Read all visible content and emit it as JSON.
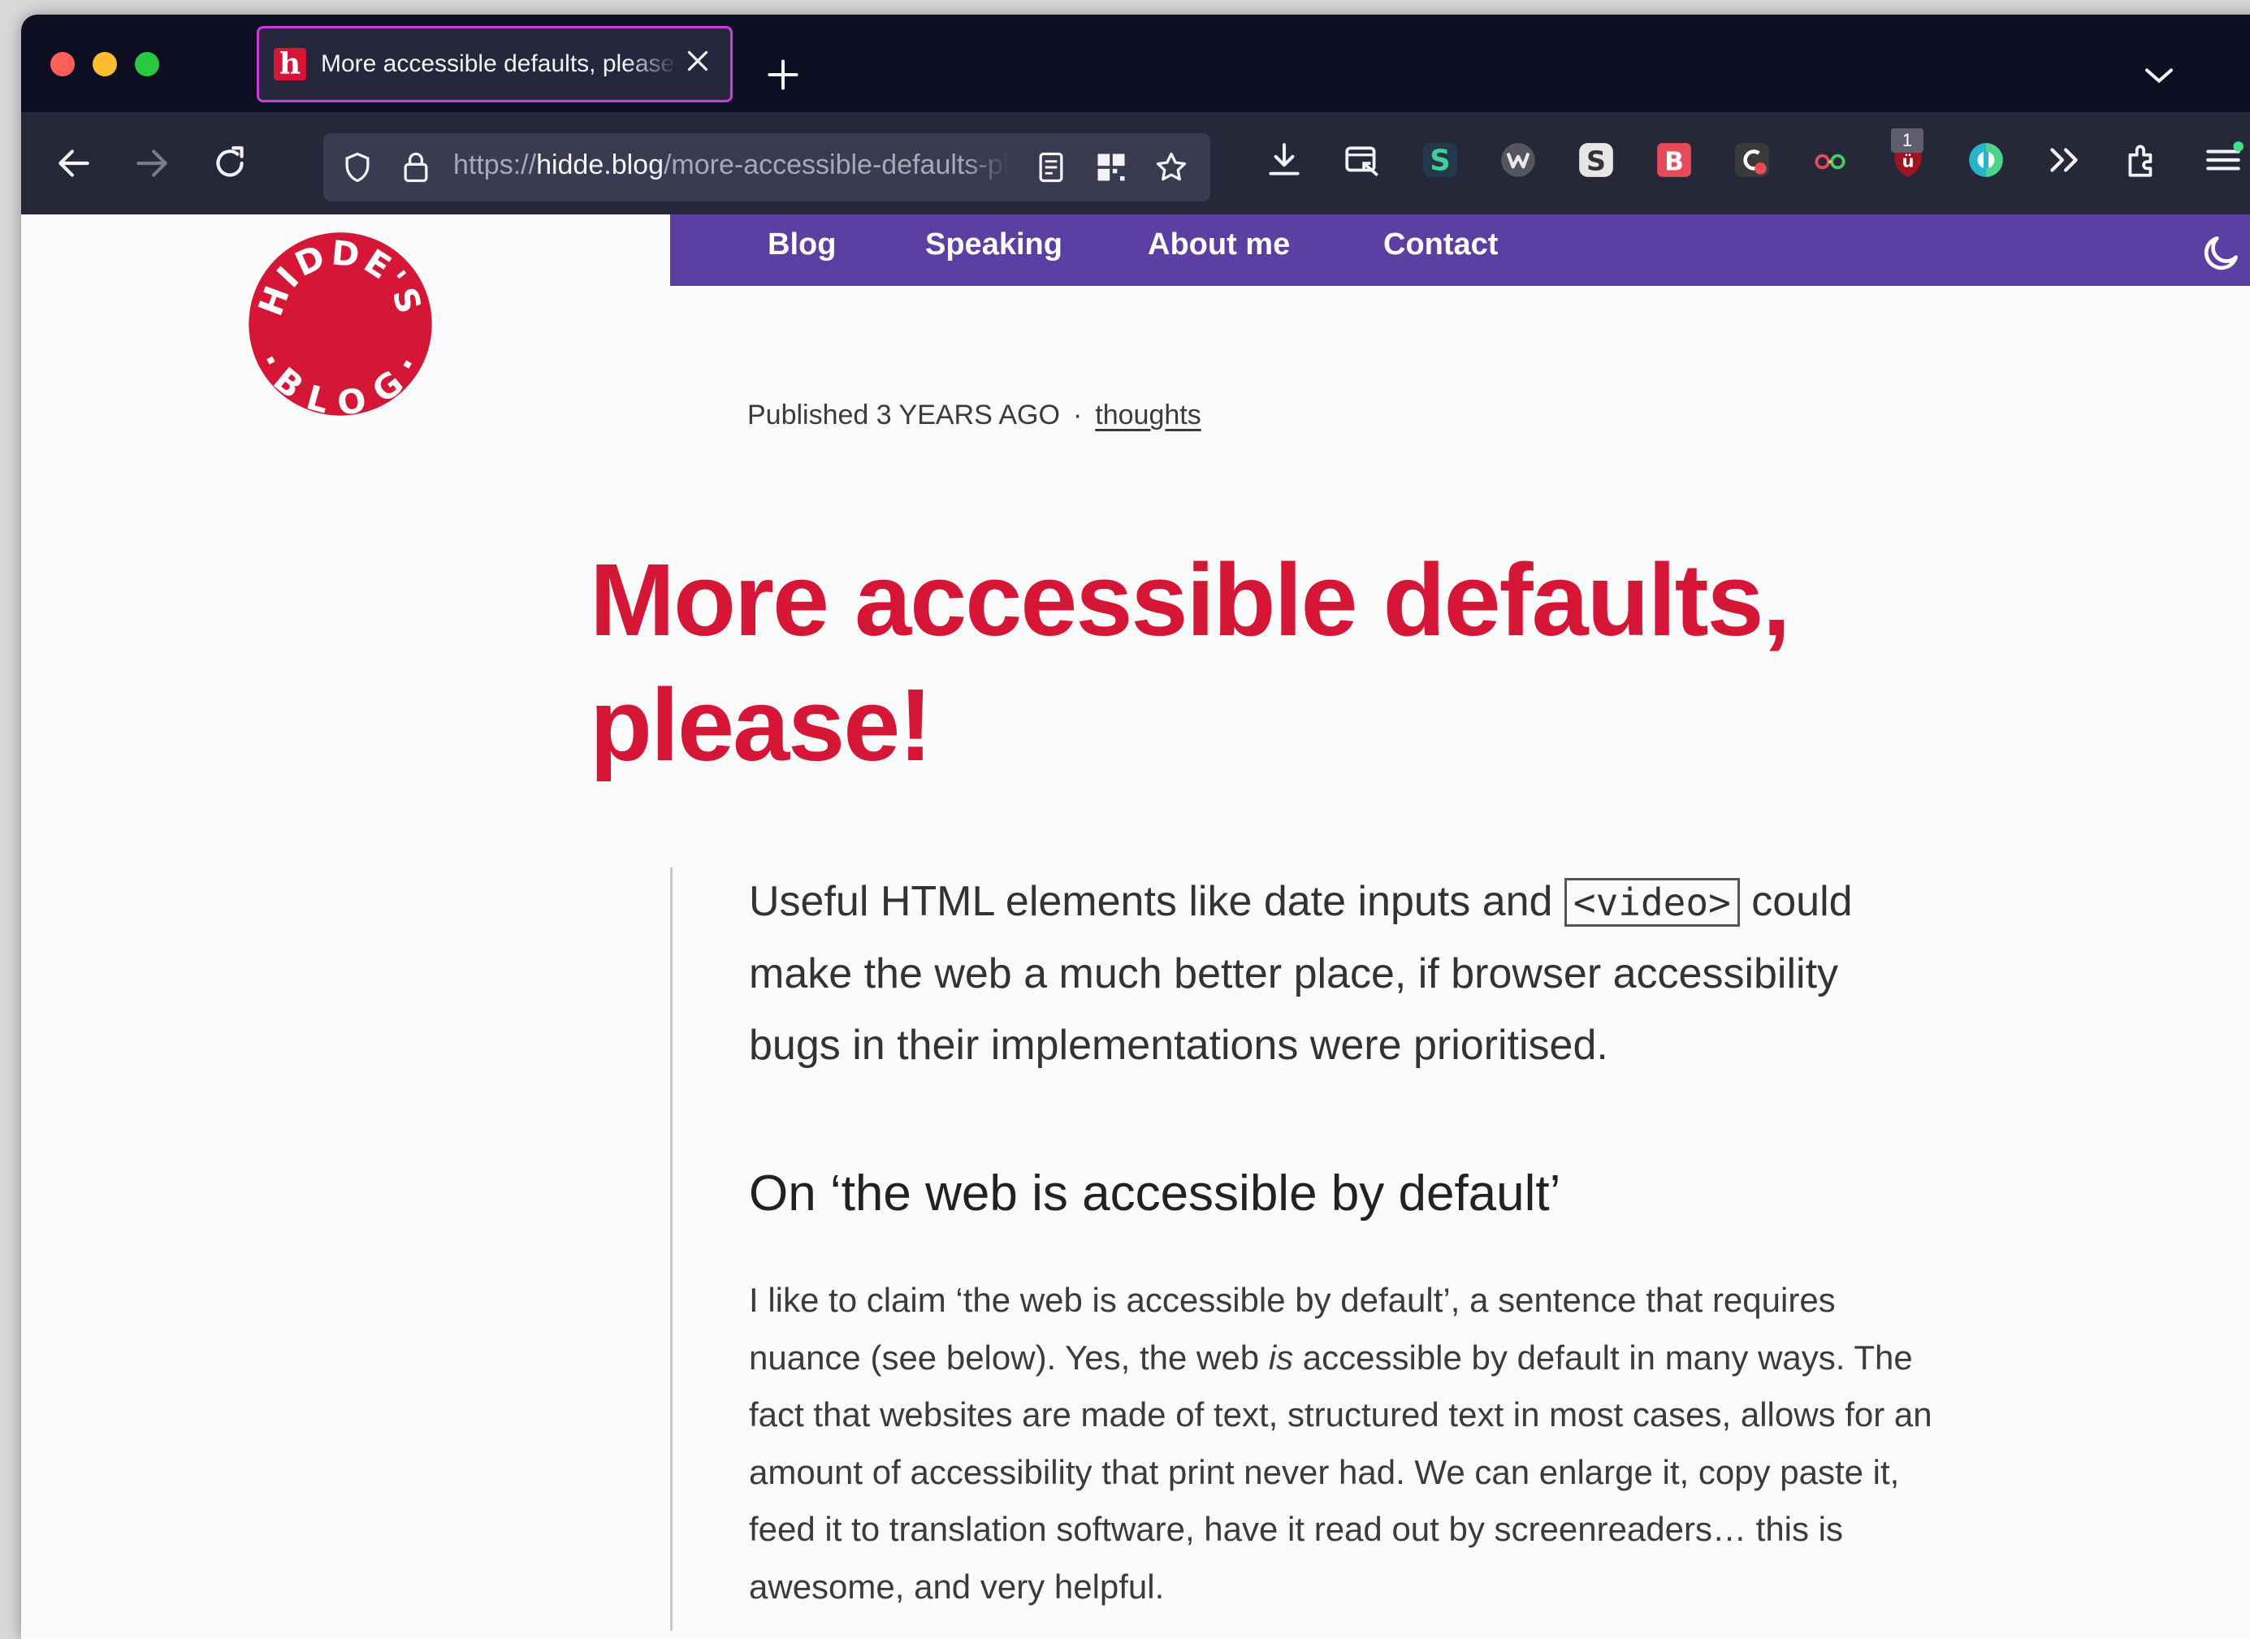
{
  "browser": {
    "tab": {
      "title": "More accessible defaults, please! | Hidde's blog",
      "favicon_letter": "h"
    },
    "url": {
      "scheme": "https://",
      "host": "hidde.blog",
      "path": "/more-accessible-defaults-please/"
    },
    "extension_badge": "1",
    "extensions": [
      "download-icon",
      "screenshot-icon",
      "s-extension-icon",
      "w-extension-icon",
      "s-grey-extension-icon",
      "b-extension-icon",
      "c-extension-icon",
      "glasses-extension-icon",
      "ublock-icon",
      "circle-extension-icon",
      "overflow-icon",
      "extensions-icon",
      "menu-icon"
    ]
  },
  "site": {
    "logo_text": "HIDDE'S BLOG",
    "logo_color": "#d51637",
    "nav": [
      "Blog",
      "Speaking",
      "About me",
      "Contact"
    ],
    "nav_color": "#5b3fa3"
  },
  "article": {
    "meta_prefix": "Published 3 YEARS AGO",
    "meta_separator": "·",
    "category": "thoughts",
    "title": "More accessible defaults, please!",
    "intro_before": "Useful HTML elements like date inputs and ",
    "intro_code": "<video>",
    "intro_after": " could make the web a much better place, if browser accessibility bugs in their implementations were prioritised.",
    "subheading": "On ‘the web is accessible by default’",
    "body_before": "I like to claim ‘the web is accessible by default’, a sentence that requires nuance (see below). Yes, the web ",
    "body_em": "is",
    "body_after": " accessible by default in many ways. The fact that websites are made of text, structured text in most cases, allows for an amount of accessibility that print never had. We can enlarge it, copy paste it, feed it to translation software, have it read out by screenreaders… this is awesome, and very helpful."
  }
}
